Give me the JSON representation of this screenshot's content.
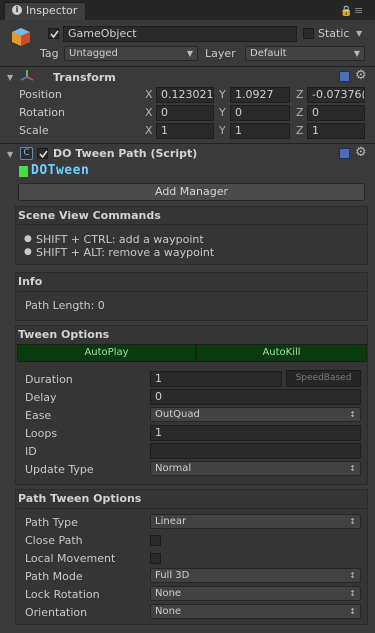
{
  "window": {
    "tab_label": "Inspector"
  },
  "gameobject": {
    "name": "GameObject",
    "static_label": "Static",
    "tag_label": "Tag",
    "tag_value": "Untagged",
    "layer_label": "Layer",
    "layer_value": "Default"
  },
  "transform": {
    "title": "Transform",
    "position": {
      "label": "Position",
      "x": "0.123021",
      "y": "1.0927",
      "z": "-0.07376("
    },
    "rotation": {
      "label": "Rotation",
      "x": "0",
      "y": "0",
      "z": "0"
    },
    "scale": {
      "label": "Scale",
      "x": "1",
      "y": "1",
      "z": "1"
    },
    "axis_x": "X",
    "axis_y": "Y",
    "axis_z": "Z"
  },
  "dotween": {
    "title": "DO Tween Path (Script)",
    "logo_text": "DOTween",
    "add_manager_label": "Add Manager",
    "scene_view": {
      "title": "Scene View Commands",
      "cmd1": "SHIFT + CTRL: add a waypoint",
      "cmd2": "SHIFT + ALT: remove a waypoint"
    },
    "info": {
      "title": "Info",
      "path_length": "Path Length: 0"
    },
    "tween_options": {
      "title": "Tween Options",
      "autoplay": "AutoPlay",
      "autokill": "AutoKill",
      "duration_label": "Duration",
      "duration_value": "1",
      "speedbased": "SpeedBased",
      "delay_label": "Delay",
      "delay_value": "0",
      "ease_label": "Ease",
      "ease_value": "OutQuad",
      "loops_label": "Loops",
      "loops_value": "1",
      "id_label": "ID",
      "id_value": "",
      "update_label": "Update Type",
      "update_value": "Normal"
    },
    "path_options": {
      "title": "Path Tween Options",
      "path_type_label": "Path Type",
      "path_type_value": "Linear",
      "close_path_label": "Close Path",
      "local_move_label": "Local Movement",
      "path_mode_label": "Path Mode",
      "path_mode_value": "Full 3D",
      "lock_rot_label": "Lock Rotation",
      "lock_rot_value": "None",
      "orientation_label": "Orientation",
      "orientation_value": "None"
    }
  },
  "colors": {
    "green_bar": "#083b0e",
    "green_text": "#9fe39f",
    "logo_green": "#3fe23f",
    "logo_cyan": "#6fd0ff"
  }
}
